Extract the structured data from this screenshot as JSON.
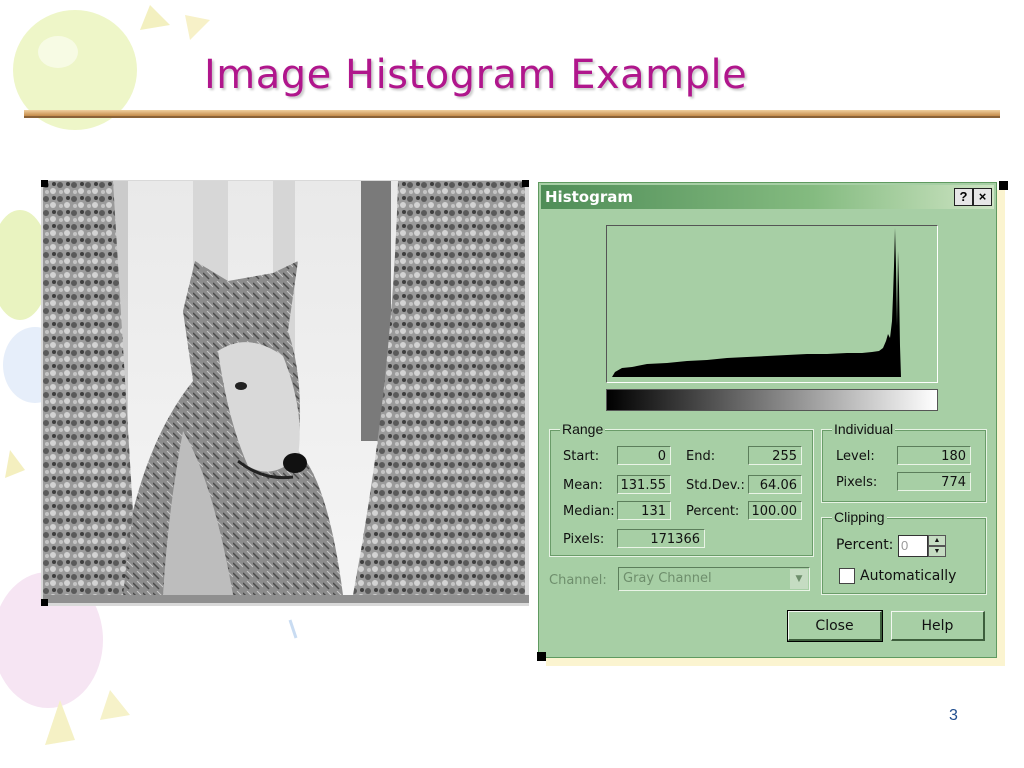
{
  "slide": {
    "title": "Image Histogram Example",
    "page_number": "3"
  },
  "photo": {
    "subject": "gray-wolf-between-trees"
  },
  "dialog": {
    "title": "Histogram",
    "help_button": "?",
    "close_x": "×",
    "histogram": {
      "level_range": [
        0,
        255
      ],
      "peak_level": 180
    },
    "range": {
      "group_label": "Range",
      "start_label": "Start:",
      "start_value": "0",
      "end_label": "End:",
      "end_value": "255",
      "mean_label": "Mean:",
      "mean_value": "131.55",
      "stddev_label": "Std.Dev.:",
      "stddev_value": "64.06",
      "median_label": "Median:",
      "median_value": "131",
      "percent_label": "Percent:",
      "percent_value": "100.00",
      "pixels_label": "Pixels:",
      "pixels_value": "171366"
    },
    "individual": {
      "group_label": "Individual",
      "level_label": "Level:",
      "level_value": "180",
      "pixels_label": "Pixels:",
      "pixels_value": "774"
    },
    "clipping": {
      "group_label": "Clipping",
      "percent_label": "Percent:",
      "percent_value": "0",
      "automatically_label": "Automatically",
      "automatically_checked": false
    },
    "channel": {
      "label": "Channel:",
      "selected": "Gray Channel"
    },
    "buttons": {
      "close": "Close",
      "help": "Help"
    }
  },
  "colors": {
    "title": "#b0168c",
    "dialog_bg": "#a7cfa5",
    "titlebar_start": "#4f8d57",
    "page_number": "#1f4d8f"
  }
}
